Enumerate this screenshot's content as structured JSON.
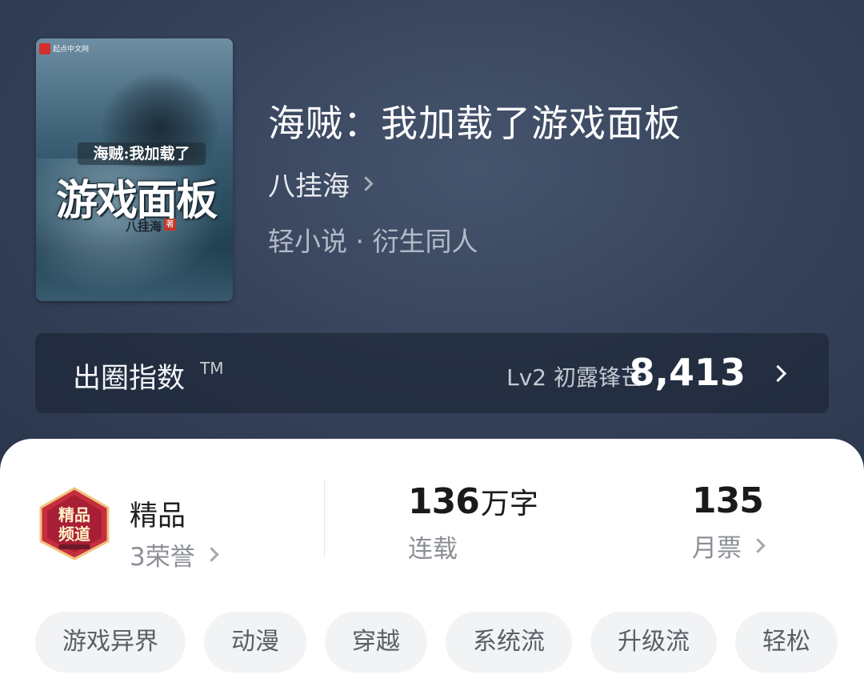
{
  "cover": {
    "publisher": "起点中文网",
    "subtitle": "海贼:我加载了",
    "title": "游戏面板",
    "author": "八挂海",
    "seal": "著"
  },
  "book": {
    "title": "海贼：我加载了游戏面板",
    "author": "八挂海",
    "category": "轻小说 · 衍生同人"
  },
  "index_bar": {
    "label": "出圈指数",
    "tm": "TM",
    "level": "Lv2 初露锋芒",
    "value": "8,413"
  },
  "badge": {
    "title": "精品",
    "subtitle": "3荣誉",
    "art_text": "精品频道"
  },
  "stats": {
    "words": {
      "number": "136",
      "unit": "万字",
      "label": "连载"
    },
    "tickets": {
      "number": "135",
      "label": "月票"
    }
  },
  "tags": [
    "游戏异界",
    "动漫",
    "穿越",
    "系统流",
    "升级流",
    "轻松"
  ],
  "colors": {
    "hero_bg": "#36435b",
    "panel_bg": "#ffffff",
    "tag_bg": "#f2f3f5",
    "badge_red": "#c62e3e"
  }
}
